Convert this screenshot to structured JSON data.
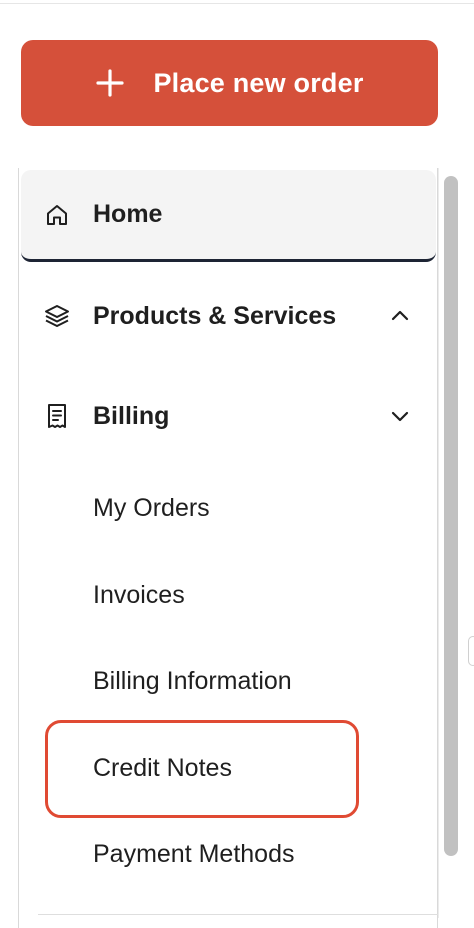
{
  "actions": {
    "new_order_label": "Place new order"
  },
  "nav": {
    "home": "Home",
    "products": "Products & Services",
    "billing": "Billing",
    "billing_items": [
      "My Orders",
      "Invoices",
      "Billing Information",
      "Credit Notes",
      "Payment Methods"
    ]
  },
  "colors": {
    "accent": "#d5503a",
    "highlight": "#e04a33",
    "active_border": "#1d2434"
  },
  "icons": {
    "new_order": "plus-icon",
    "home": "home-icon",
    "products": "layers-icon",
    "billing": "receipt-icon",
    "products_toggle": "chevron-up-icon",
    "billing_toggle": "chevron-down-icon"
  }
}
